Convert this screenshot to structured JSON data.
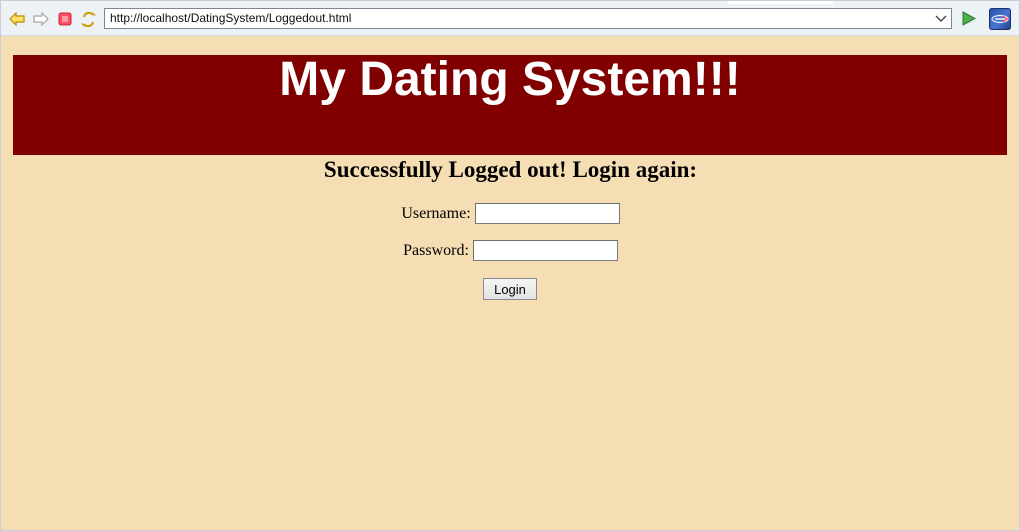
{
  "browser": {
    "address_url": "http://localhost/DatingSystem/Loggedout.html",
    "icons": {
      "back": "back-icon",
      "forward": "forward-icon",
      "stop": "stop-icon",
      "refresh": "refresh-icon",
      "dropdown": "chevron-down-icon",
      "go": "go-icon",
      "browser_logo": "browser-logo-icon"
    }
  },
  "page": {
    "title": "My Dating System!!!",
    "status_heading": "Successfully Logged out! Login again:",
    "form": {
      "username_label": "Username:",
      "username_value": "",
      "password_label": "Password:",
      "password_value": "",
      "login_button": "Login"
    }
  },
  "colors": {
    "page_background": "#f5deb3",
    "banner_background": "#800000",
    "banner_text": "#ffffff",
    "toolbar_background": "#edf2f7"
  }
}
